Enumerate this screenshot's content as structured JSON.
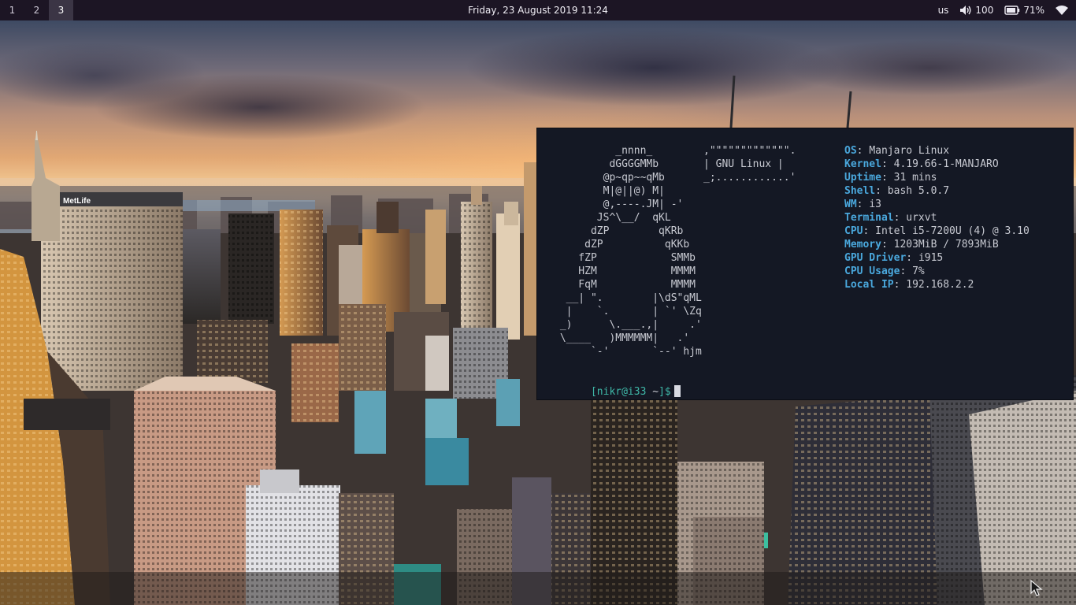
{
  "topbar": {
    "workspaces": [
      {
        "label": "1",
        "active": false
      },
      {
        "label": "2",
        "active": false
      },
      {
        "label": "3",
        "active": true
      }
    ],
    "datetime": "Friday, 23 August 2019 11:24",
    "keyboard_layout": "us",
    "volume": "100",
    "battery": "71%",
    "icons": [
      "volume-icon",
      "battery-icon",
      "wifi-icon"
    ]
  },
  "wallpaper": {
    "sign_text": "MetLife"
  },
  "terminal": {
    "ascii_art": "          _nnnn_\n         dGGGGMMb\n        @p~qp~~qMb\n        M|@||@) M|\n        @,----.JM| -'\n       JS^\\__/  qKL\n      dZP        qKRb\n     dZP          qKKb\n    fZP            SMMb\n    HZM            MMMM\n    FqM            MMMM\n  __| \".        |\\dS\"qML\n  |    `.       | `' \\Zq\n _)      \\.___.,|     .'\n \\____   )MMMMMM|   .'\n      `-'       `--' hjm",
    "banner": ",\"\"\"\"\"\"\"\"\"\"\"\"\".\n| GNU Linux |\n_;............'",
    "info": [
      {
        "key": "OS",
        "value": "Manjaro Linux"
      },
      {
        "key": "Kernel",
        "value": "4.19.66-1-MANJARO"
      },
      {
        "key": "Uptime",
        "value": "31 mins"
      },
      {
        "key": "Shell",
        "value": "bash 5.0.7"
      },
      {
        "key": "WM",
        "value": "i3"
      },
      {
        "key": "Terminal",
        "value": "urxvt"
      },
      {
        "key": "CPU",
        "value": "Intel i5-7200U (4) @ 3.10"
      },
      {
        "key": "Memory",
        "value": "1203MiB / 7893MiB"
      },
      {
        "key": "GPU Driver",
        "value": "i915"
      },
      {
        "key": "CPU Usage",
        "value": "7%"
      },
      {
        "key": "Local IP",
        "value": "192.168.2.2"
      }
    ],
    "prompt_user": "[nikr@i33",
    "prompt_dir": " ~",
    "prompt_end": "]$"
  },
  "colors": {
    "topbar_bg": "#1c1524",
    "terminal_bg": "#141824",
    "info_key": "#4aa8dd",
    "prompt": "#3fb8a8"
  }
}
